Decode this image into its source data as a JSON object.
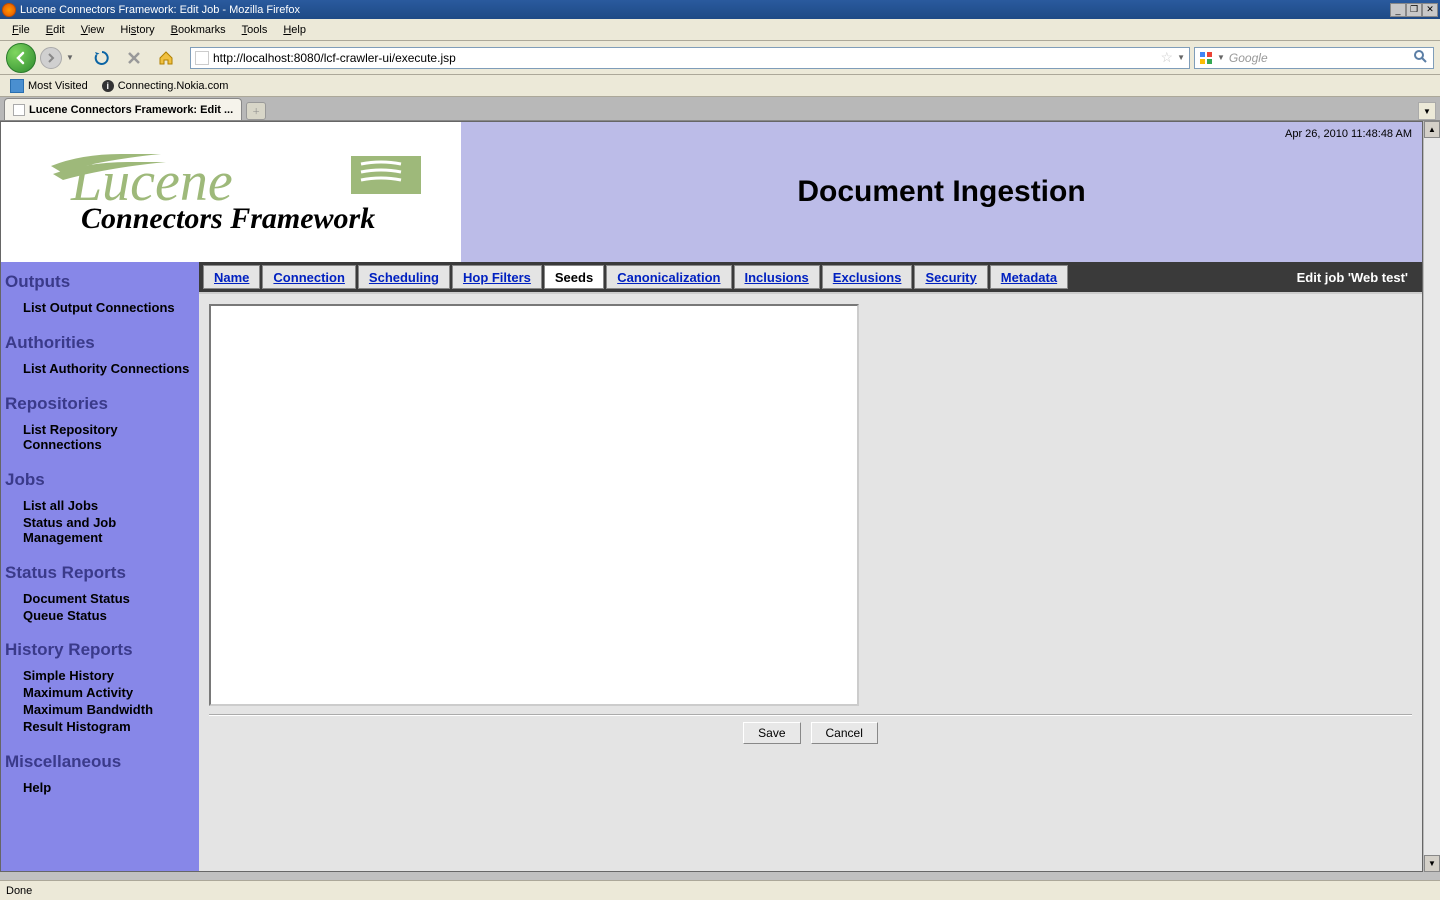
{
  "window": {
    "title": "Lucene Connectors Framework: Edit Job - Mozilla Firefox",
    "min_icon": "_",
    "max_icon": "❐",
    "close_icon": "✕"
  },
  "menubar": [
    "File",
    "Edit",
    "View",
    "History",
    "Bookmarks",
    "Tools",
    "Help"
  ],
  "nav": {
    "url": "http://localhost:8080/lcf-crawler-ui/execute.jsp",
    "search_placeholder": "Google"
  },
  "bookmarks": {
    "item1": "Most Visited",
    "item2": "Connecting.Nokia.com"
  },
  "browser_tab": "Lucene Connectors Framework: Edit ...",
  "banner": {
    "timestamp": "Apr 26, 2010 11:48:48 AM",
    "title": "Document Ingestion",
    "logo_top": "Lucene",
    "logo_bottom": "Connectors Framework"
  },
  "sidebar": {
    "sections": [
      {
        "heading": "Outputs",
        "links": [
          "List Output Connections"
        ]
      },
      {
        "heading": "Authorities",
        "links": [
          "List Authority Connections"
        ]
      },
      {
        "heading": "Repositories",
        "links": [
          "List Repository Connections"
        ]
      },
      {
        "heading": "Jobs",
        "links": [
          "List all Jobs",
          "Status and Job Management"
        ]
      },
      {
        "heading": "Status Reports",
        "links": [
          "Document Status",
          "Queue Status"
        ]
      },
      {
        "heading": "History Reports",
        "links": [
          "Simple History",
          "Maximum Activity",
          "Maximum Bandwidth",
          "Result Histogram"
        ]
      },
      {
        "heading": "Miscellaneous",
        "links": [
          "Help"
        ]
      }
    ]
  },
  "page_tabs": {
    "items": [
      "Name",
      "Connection",
      "Scheduling",
      "Hop Filters",
      "Seeds",
      "Canonicalization",
      "Inclusions",
      "Exclusions",
      "Security",
      "Metadata"
    ],
    "active_index": 4,
    "right_text": "Edit job 'Web test'"
  },
  "form": {
    "seeds_value": "",
    "save_label": "Save",
    "cancel_label": "Cancel"
  },
  "statusbar": {
    "text": "Done"
  }
}
